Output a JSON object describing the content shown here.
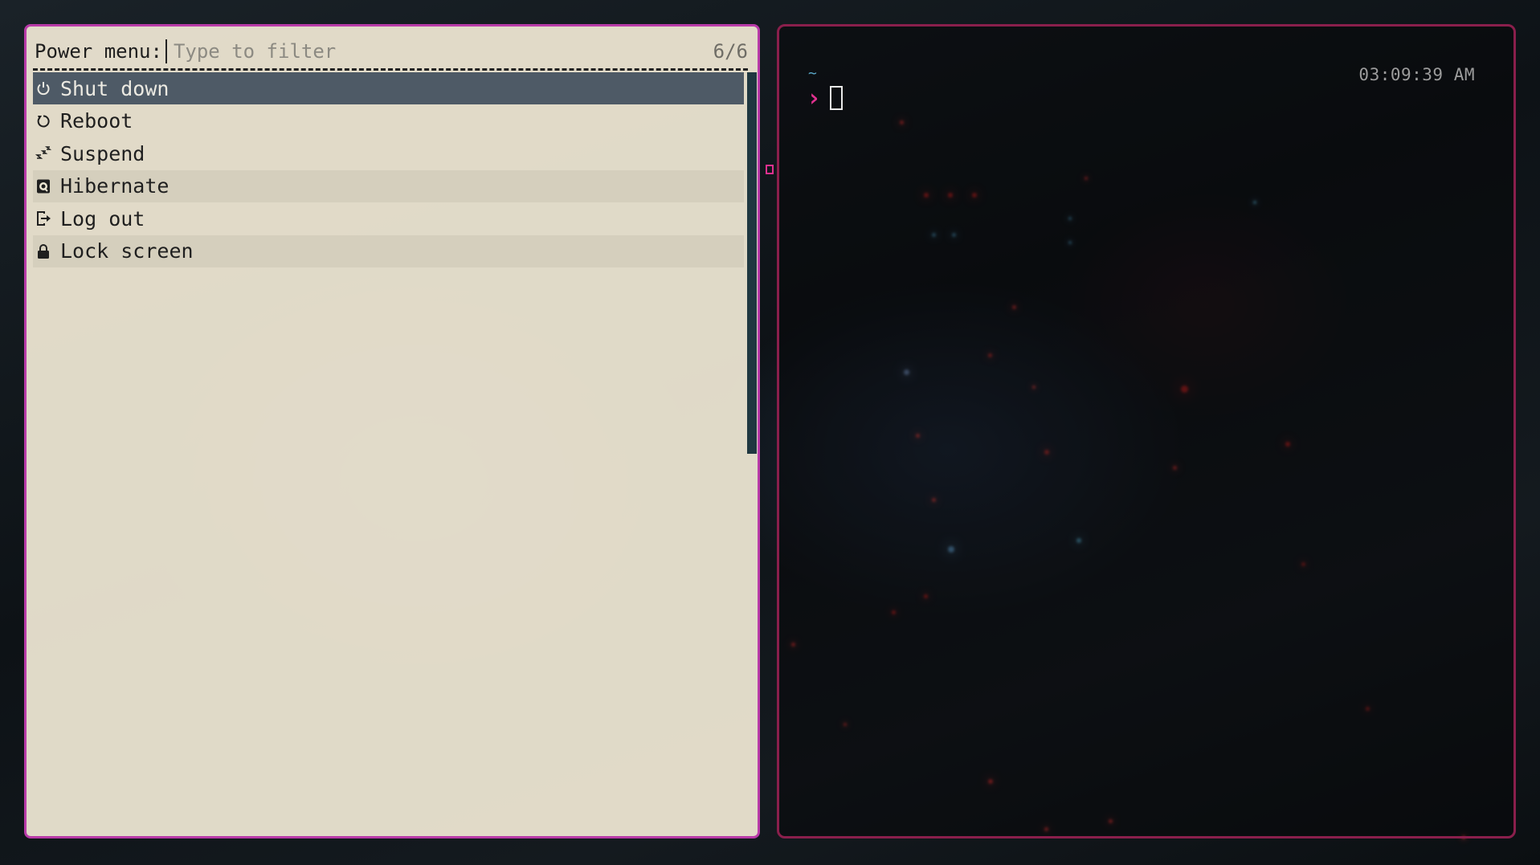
{
  "menu": {
    "prompt_label": "Power menu:",
    "filter_placeholder": "Type to filter",
    "match_count": "6/6",
    "items": [
      {
        "label": "Shut down",
        "icon": "power-icon"
      },
      {
        "label": "Reboot",
        "icon": "reboot-icon"
      },
      {
        "label": "Suspend",
        "icon": "sleep-icon"
      },
      {
        "label": "Hibernate",
        "icon": "hibernate-icon"
      },
      {
        "label": "Log out",
        "icon": "logout-icon"
      },
      {
        "label": "Lock screen",
        "icon": "lock-icon"
      }
    ],
    "selected_index": 0
  },
  "terminal": {
    "cwd": "~",
    "prompt_symbol": "›",
    "clock": "03:09:39 AM"
  },
  "colors": {
    "menu_border": "#b83aa8",
    "terminal_border": "#8a1f4c",
    "selected_row": "#4e5a66",
    "prompt_accent": "#e0318f",
    "cwd_color": "#5aa8c8",
    "scrollbar": "#1f3740"
  }
}
